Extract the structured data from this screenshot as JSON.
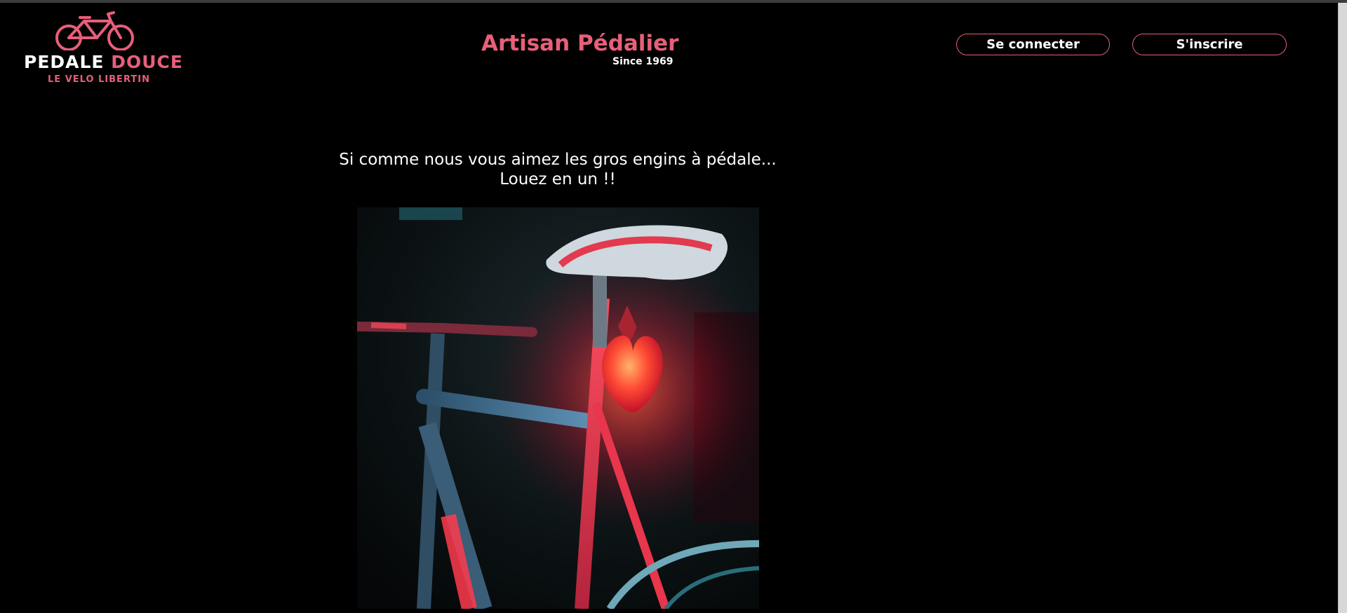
{
  "logo": {
    "brand_word1": "PEDALE",
    "brand_word2": "DOUCE",
    "tagline": "LE VELO LIBERTIN",
    "icon": "bicycle-icon"
  },
  "header": {
    "title": "Artisan Pédalier",
    "subtitle": "Since 1969"
  },
  "auth": {
    "login_label": "Se connecter",
    "signup_label": "S'inscrire"
  },
  "main": {
    "intro_line1": "Si comme nous vous aimez les gros engins à pédale...",
    "intro_line2": "Louez en un !!",
    "hero_image": "bicycle-with-red-light-photo"
  },
  "colors": {
    "accent": "#e75f79",
    "background": "#000000",
    "text": "#ffffff"
  }
}
